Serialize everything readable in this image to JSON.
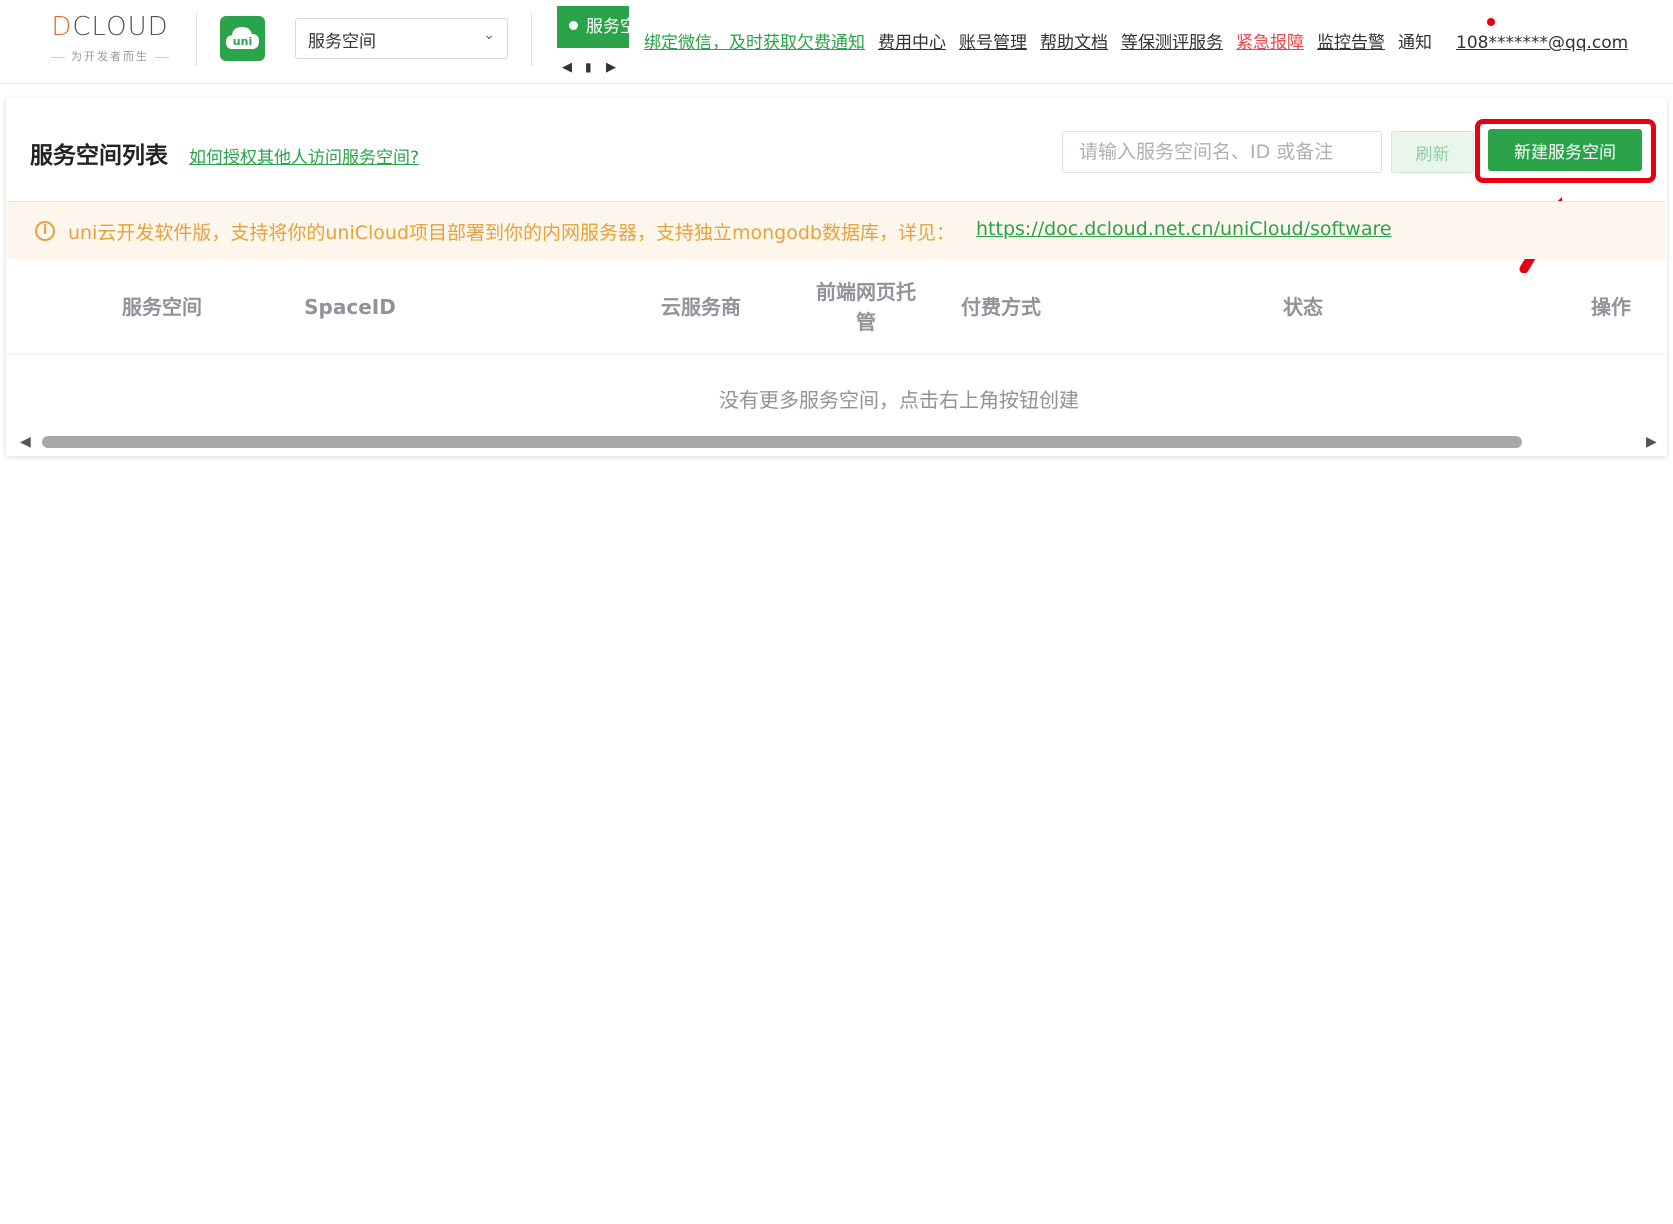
{
  "header": {
    "logo_text": "DCLOUD",
    "logo_tagline": "为开发者而生",
    "uni_icon_label": "uni",
    "space_select": {
      "value": "服务空间"
    },
    "status_tab_label": "服务空间",
    "nav": [
      {
        "label": "绑定微信，及时获取欠费通知",
        "style": "green"
      },
      {
        "label": "费用中心",
        "style": "link"
      },
      {
        "label": "账号管理",
        "style": "link"
      },
      {
        "label": "帮助文档",
        "style": "link"
      },
      {
        "label": "等保测评服务",
        "style": "link"
      },
      {
        "label": "紧急报障",
        "style": "red"
      },
      {
        "label": "监控告警",
        "style": "link"
      },
      {
        "label": "通知",
        "style": "plain"
      },
      {
        "label": "108*******@qq.com",
        "style": "link"
      }
    ]
  },
  "card": {
    "title": "服务空间列表",
    "help_link": "如何授权其他人访问服务空间?",
    "search_placeholder": "请输入服务空间名、ID 或备注",
    "refresh_label": "刷新",
    "new_label": "新建服务空间",
    "notice": {
      "text": "uni云开发软件版，支持将你的uniCloud项目部署到你的内网服务器，支持独立mongodb数据库，详见：",
      "link": "https://doc.dcloud.net.cn/uniCloud/software"
    },
    "columns": [
      "服务空间",
      "SpaceID",
      "云服务商",
      "前端网页托管",
      "付费方式",
      "状态",
      "操作"
    ],
    "empty_text": "没有更多服务空间，点击右上角按钮创建"
  },
  "colors": {
    "brand_green": "#2aa34a",
    "warning": "#e6a23c",
    "alert_red": "#e60012"
  }
}
